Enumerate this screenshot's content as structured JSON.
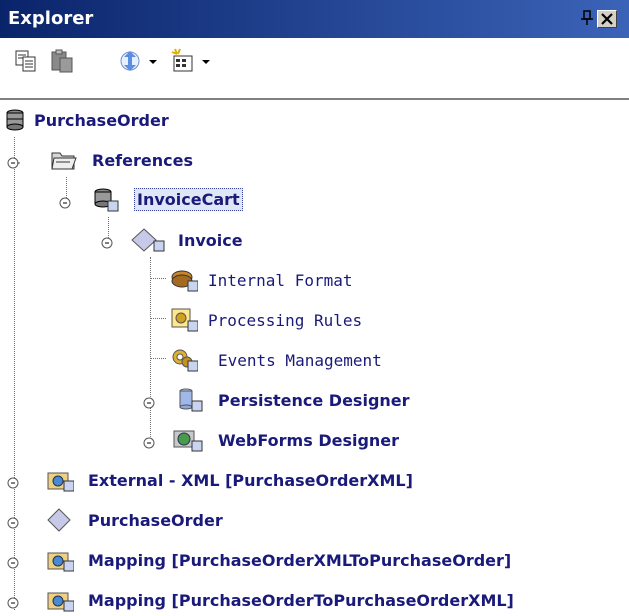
{
  "window": {
    "title": "Explorer"
  },
  "toolbar": {
    "copy_icon": "copy-icon",
    "paste_icon": "paste-icon",
    "sync_icon": "sync-icon",
    "new_icon": "new-item-icon"
  },
  "tree": {
    "root": "PurchaseOrder",
    "references": "References",
    "invoice_cart": "InvoiceCart",
    "invoice": "Invoice",
    "internal_format": "Internal Format",
    "processing_rules": "Processing Rules",
    "events_management": "Events Management",
    "persistence_designer": "Persistence Designer",
    "webforms_designer": "WebForms Designer",
    "external_xml": "External - XML [PurchaseOrderXML]",
    "purchase_order": "PurchaseOrder",
    "mapping_1": "Mapping [PurchaseOrderXMLToPurchaseOrder]",
    "mapping_2": "Mapping [PurchaseOrderToPurchaseOrderXML]"
  },
  "colors": {
    "titlebar_start": "#0a246a",
    "titlebar_end": "#3b63b8",
    "label": "#1a1a7a",
    "selection": "#dfe6f5"
  }
}
